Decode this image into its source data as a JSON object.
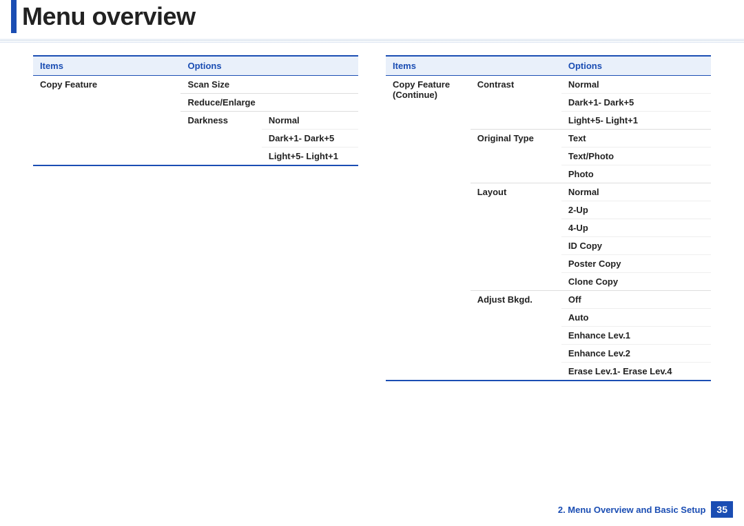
{
  "title": "Menu overview",
  "headers": {
    "items": "Items",
    "options": "Options"
  },
  "left": {
    "item": "Copy Feature",
    "rows": [
      {
        "sub": "Scan Size",
        "opts": []
      },
      {
        "sub": "Reduce/Enlarge",
        "opts": []
      },
      {
        "sub": "Darkness",
        "opts": [
          "Normal",
          "Dark+1- Dark+5",
          "Light+5- Light+1"
        ]
      }
    ]
  },
  "right": {
    "item": "Copy Feature (Continue)",
    "rows": [
      {
        "sub": "Contrast",
        "opts": [
          "Normal",
          "Dark+1- Dark+5",
          "Light+5- Light+1"
        ]
      },
      {
        "sub": "Original Type",
        "opts": [
          "Text",
          "Text/Photo",
          "Photo"
        ]
      },
      {
        "sub": "Layout",
        "opts": [
          "Normal",
          "2-Up",
          "4-Up",
          "ID Copy",
          "Poster Copy",
          "Clone Copy"
        ]
      },
      {
        "sub": "Adjust Bkgd.",
        "opts": [
          "Off",
          "Auto",
          "Enhance Lev.1",
          "Enhance Lev.2",
          "Erase Lev.1- Erase Lev.4"
        ]
      }
    ]
  },
  "footer": {
    "section": "2.  Menu Overview and Basic Setup",
    "page": "35"
  }
}
